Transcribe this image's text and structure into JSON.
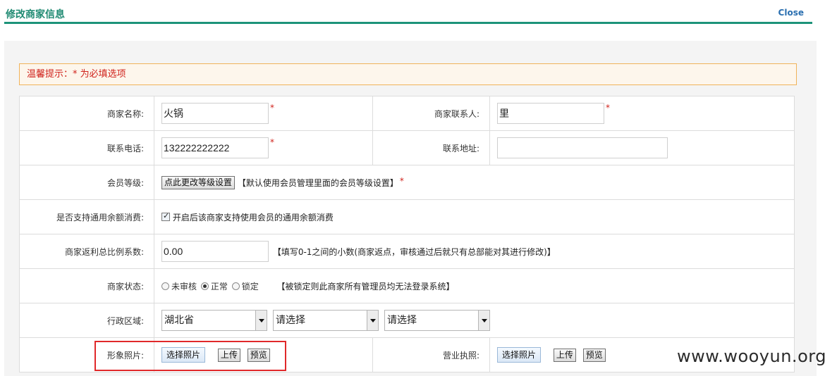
{
  "header": {
    "title": "修改商家信息",
    "close_label": "Close"
  },
  "notice": "温馨提示：* 为必填选项",
  "required_mark": "*",
  "fields": {
    "name": {
      "label": "商家名称:",
      "value": "火锅"
    },
    "contact": {
      "label": "商家联系人:",
      "value": "里"
    },
    "phone": {
      "label": "联系电话:",
      "value": "132222222222"
    },
    "address": {
      "label": "联系地址:",
      "value": ""
    },
    "level": {
      "label": "会员等级:",
      "button": "点此更改等级设置",
      "hint": "【默认使用会员管理里面的会员等级设置】"
    },
    "balance": {
      "label": "是否支持通用余额消费:",
      "checked": true,
      "hint": "开启后该商家支持使用会员的通用余额消费"
    },
    "ratio": {
      "label": "商家返利总比例系数:",
      "value": "0.00",
      "hint": "【填写0-1之间的小数(商家返点，审核通过后就只有总部能对其进行修改)】"
    },
    "status": {
      "label": "商家状态:",
      "options": [
        "未审核",
        "正常",
        "锁定"
      ],
      "selected": "正常",
      "hint": "【被锁定则此商家所有管理员均无法登录系统】"
    },
    "region": {
      "label": "行政区域:",
      "province": "湖北省",
      "city": "请选择",
      "district": "请选择"
    },
    "photo": {
      "label": "形象照片:",
      "choose": "选择照片",
      "upload": "上传",
      "preview": "预览"
    },
    "license": {
      "label": "营业执照:",
      "choose": "选择照片",
      "upload": "上传",
      "preview": "预览"
    }
  },
  "watermark": "www.wooyun.org",
  "colors": {
    "accent": "#1d9379",
    "required": "#d0231c",
    "highlight_box": "#e0282a"
  }
}
